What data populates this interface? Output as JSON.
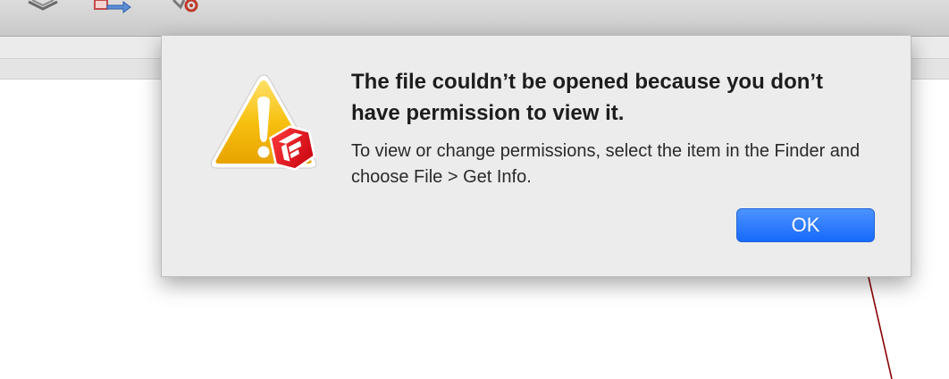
{
  "toolbar": {
    "icons": [
      "layers-icon",
      "transfer-icon",
      "settings-icon"
    ]
  },
  "alert": {
    "title": "The file couldn’t be opened because you don’t have permission to view it.",
    "message": "To view or change permissions, select the item in the Finder and choose File > Get Info.",
    "ok_label": "OK",
    "icon": "warning-icon",
    "badge_icon": "sketchup-icon"
  },
  "colors": {
    "button_accent": "#1769fb",
    "warning_yellow": "#f2b705",
    "badge_red": "#e0141f",
    "line_color": "#8b0000"
  }
}
